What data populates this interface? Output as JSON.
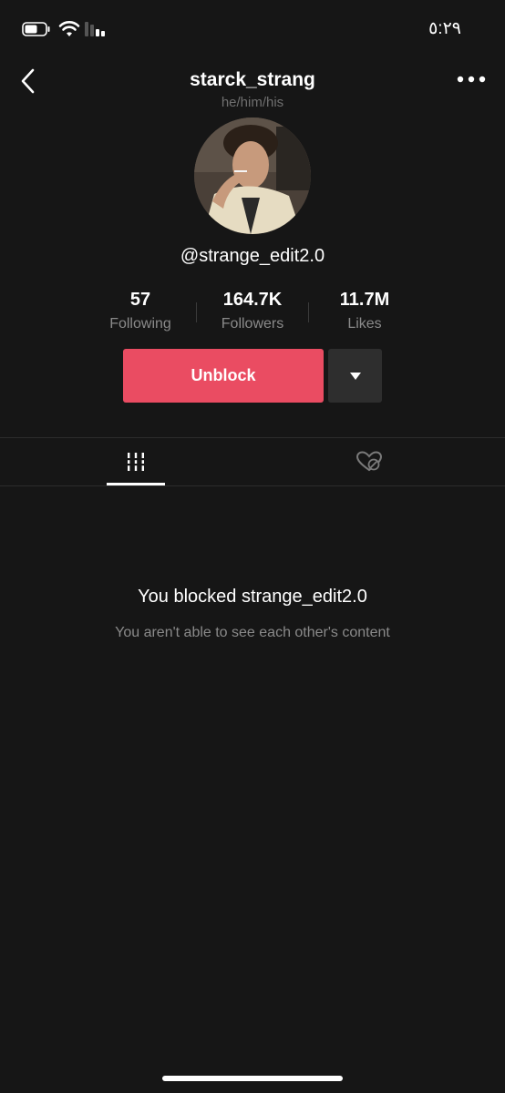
{
  "status_bar": {
    "time": "٥:٢٩"
  },
  "header": {
    "username": "starck_strang",
    "pronouns": "he/him/his"
  },
  "profile": {
    "handle": "@strange_edit2.0"
  },
  "stats": [
    {
      "value": "57",
      "label": "Following"
    },
    {
      "value": "164.7K",
      "label": "Followers"
    },
    {
      "value": "11.7M",
      "label": "Likes"
    }
  ],
  "actions": {
    "unblock_label": "Unblock"
  },
  "blocked_state": {
    "title": "You blocked strange_edit2.0",
    "subtitle": "You aren't able to see each other's content"
  },
  "colors": {
    "accent": "#ea4c62",
    "background": "#161616"
  },
  "icons": {
    "back": "chevron-left-icon",
    "more": "more-horizontal-icon",
    "dropdown": "caret-down-icon",
    "videos_tab": "grid-icon",
    "liked_tab": "heart-hidden-icon"
  }
}
